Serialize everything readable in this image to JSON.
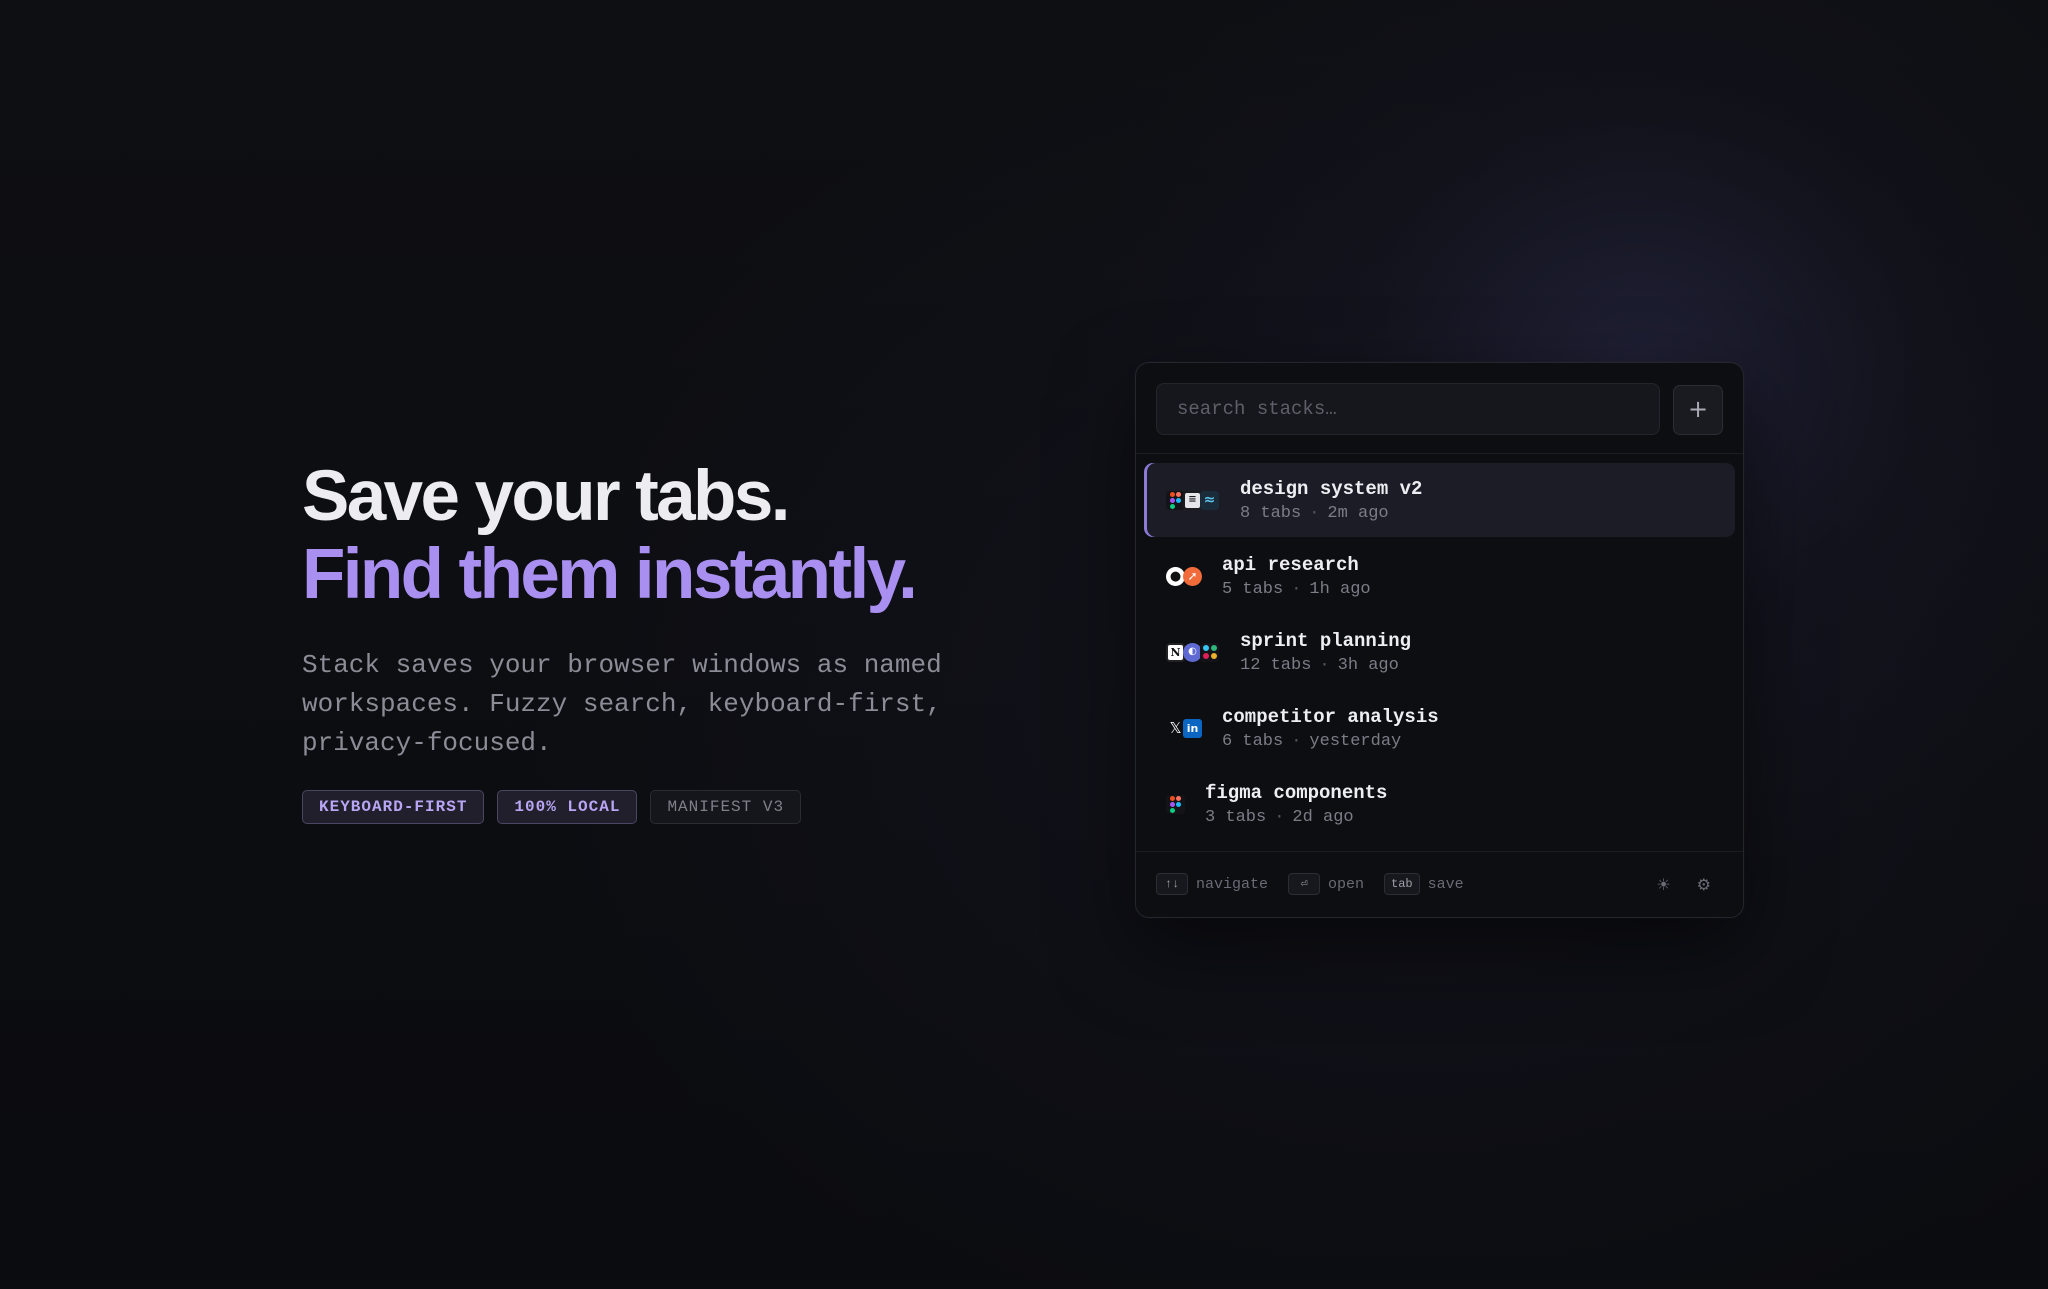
{
  "hero": {
    "title_line1": "Save your tabs.",
    "title_line2": "Find them instantly.",
    "description": "Stack saves your browser windows as named workspaces. Fuzzy search, keyboard-first, privacy-focused.",
    "badges": [
      "KEYBOARD-FIRST",
      "100% LOCAL",
      "MANIFEST V3"
    ]
  },
  "popup": {
    "search": {
      "placeholder": "search stacks…",
      "value": ""
    },
    "add_label": "+",
    "stacks": [
      {
        "name": "design system v2",
        "tabs": "8 tabs",
        "time": "2m ago",
        "selected": true,
        "icons": [
          "figma-icon",
          "document-icon",
          "wave-icon"
        ]
      },
      {
        "name": "api research",
        "tabs": "5 tabs",
        "time": "1h ago",
        "selected": false,
        "icons": [
          "github-icon",
          "postman-icon"
        ]
      },
      {
        "name": "sprint planning",
        "tabs": "12 tabs",
        "time": "3h ago",
        "selected": false,
        "icons": [
          "notion-icon",
          "linear-icon",
          "slack-icon"
        ]
      },
      {
        "name": "competitor analysis",
        "tabs": "6 tabs",
        "time": "yesterday",
        "selected": false,
        "icons": [
          "x-icon",
          "linkedin-icon"
        ]
      },
      {
        "name": "figma components",
        "tabs": "3 tabs",
        "time": "2d ago",
        "selected": false,
        "icons": [
          "figma-icon"
        ]
      }
    ],
    "separator": "·",
    "footer": {
      "navigate_key": "↑↓",
      "navigate_label": "navigate",
      "open_key": "⏎",
      "open_label": "open",
      "save_key": "tab",
      "save_label": "save",
      "theme_icon": "sun-icon",
      "settings_icon": "gear-icon",
      "theme_glyph": "☀",
      "settings_glyph": "⚙"
    }
  },
  "colors": {
    "background": "#0b0c10",
    "accent": "#a88ff0",
    "selected_row": "#1c1c27"
  }
}
